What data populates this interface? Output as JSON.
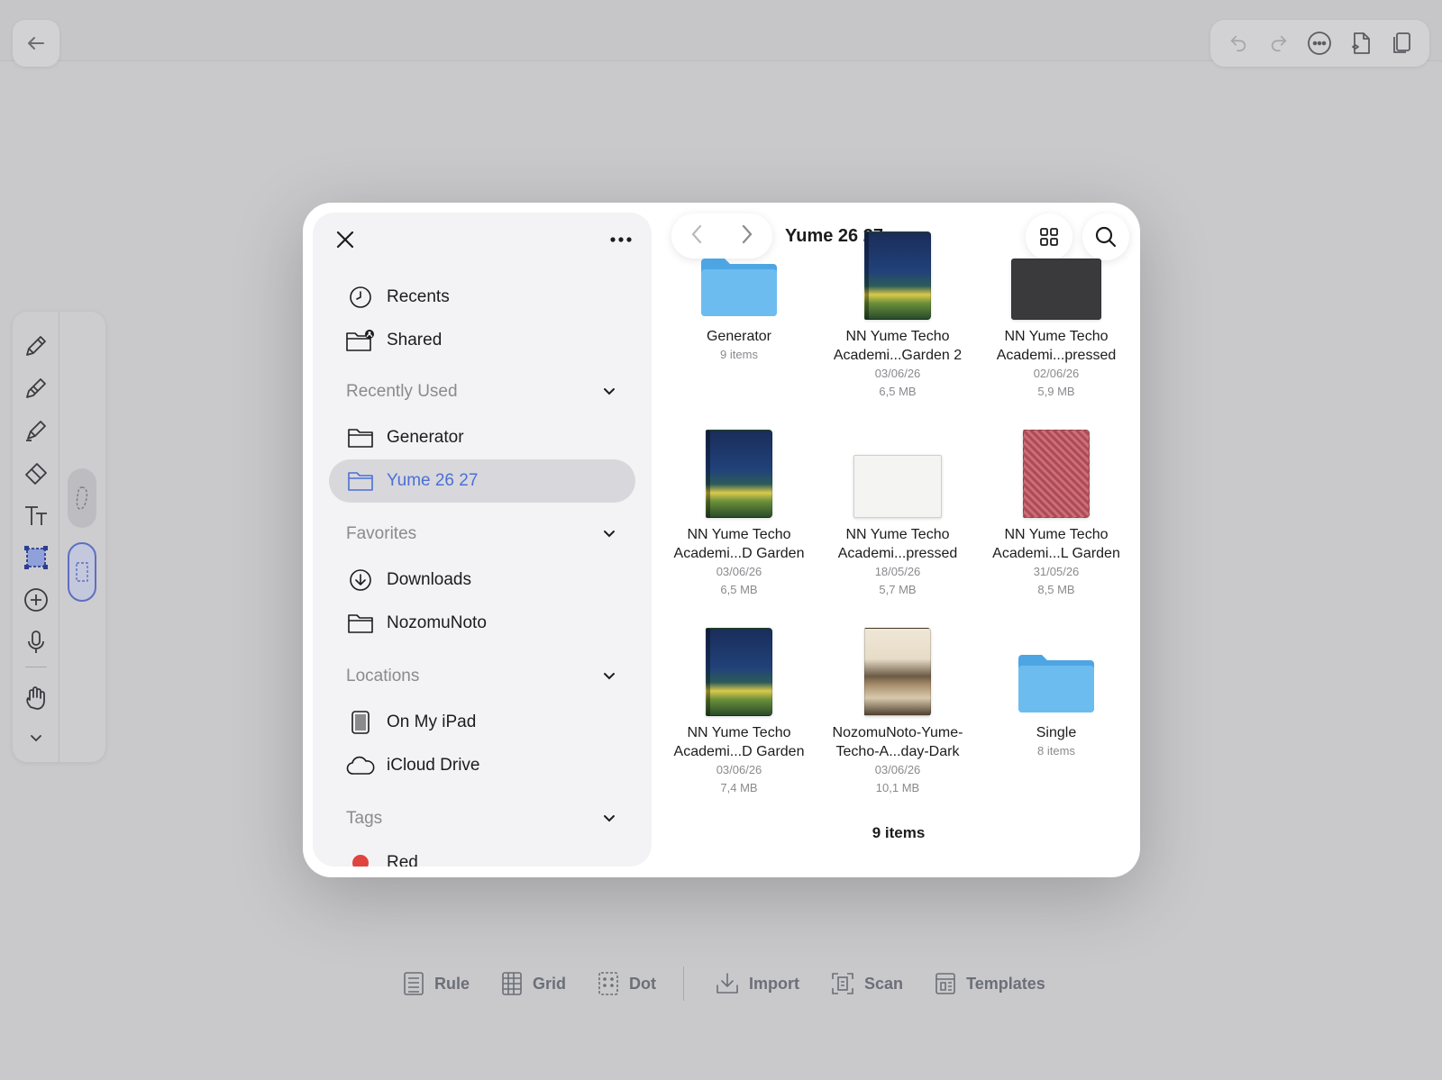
{
  "top_toolbar": {
    "back_icon": "arrow-left-icon",
    "right_icons": [
      "undo-icon",
      "redo-icon",
      "more-circle-icon",
      "new-page-icon",
      "pages-icon"
    ]
  },
  "left_toolbar": {
    "tools": [
      "pen-icon",
      "pencil-icon",
      "highlighter-icon",
      "eraser-icon",
      "text-icon",
      "selection-icon",
      "add-circle-icon",
      "microphone-icon",
      "hand-icon",
      "chevron-down-icon"
    ],
    "modes": [
      "lasso-icon",
      "rect-select-icon"
    ]
  },
  "bottom_bar": {
    "items": [
      {
        "label": "Rule",
        "icon": "rule-icon"
      },
      {
        "label": "Grid",
        "icon": "grid-icon"
      },
      {
        "label": "Dot",
        "icon": "dot-icon"
      },
      {
        "label": "Import",
        "icon": "import-icon"
      },
      {
        "label": "Scan",
        "icon": "scan-icon"
      },
      {
        "label": "Templates",
        "icon": "templates-icon"
      }
    ]
  },
  "sidebar": {
    "top": [
      {
        "label": "Recents",
        "icon": "clock-icon"
      },
      {
        "label": "Shared",
        "icon": "shared-folder-icon"
      }
    ],
    "sections": {
      "recently_used": {
        "title": "Recently Used",
        "items": [
          {
            "label": "Generator",
            "icon": "folder-icon"
          },
          {
            "label": "Yume 26 27",
            "icon": "folder-icon",
            "active": true
          }
        ]
      },
      "favorites": {
        "title": "Favorites",
        "items": [
          {
            "label": "Downloads",
            "icon": "download-icon"
          },
          {
            "label": "NozomuNoto",
            "icon": "folder-icon"
          }
        ]
      },
      "locations": {
        "title": "Locations",
        "items": [
          {
            "label": "On My iPad",
            "icon": "ipad-icon"
          },
          {
            "label": "iCloud Drive",
            "icon": "cloud-icon"
          }
        ]
      },
      "tags": {
        "title": "Tags",
        "items": [
          {
            "label": "Red",
            "color": "#e0443e"
          }
        ]
      }
    }
  },
  "browser": {
    "title": "Yume 26 27",
    "items_count": "9 items",
    "items": [
      {
        "name": [
          "Generator"
        ],
        "meta": [
          "9 items"
        ],
        "kind": "folder"
      },
      {
        "name": [
          "NN Yume Techo",
          "Academi...Garden 2"
        ],
        "meta": [
          "03/06/26",
          "6,5 MB"
        ],
        "kind": "garden"
      },
      {
        "name": [
          "NN Yume Techo",
          "Academi...pressed"
        ],
        "meta": [
          "02/06/26",
          "5,9 MB"
        ],
        "kind": "dark"
      },
      {
        "name": [
          "NN Yume Techo",
          "Academi...D Garden"
        ],
        "meta": [
          "03/06/26",
          "6,5 MB"
        ],
        "kind": "garden"
      },
      {
        "name": [
          "NN Yume Techo",
          "Academi...pressed"
        ],
        "meta": [
          "18/05/26",
          "5,7 MB"
        ],
        "kind": "spread"
      },
      {
        "name": [
          "NN Yume Techo",
          "Academi...L Garden"
        ],
        "meta": [
          "31/05/26",
          "8,5 MB"
        ],
        "kind": "red"
      },
      {
        "name": [
          "NN Yume Techo",
          "Academi...D Garden"
        ],
        "meta": [
          "03/06/26",
          "7,4 MB"
        ],
        "kind": "garden"
      },
      {
        "name": [
          "NozomuNoto-Yume-",
          "Techo-A...day-Dark"
        ],
        "meta": [
          "03/06/26",
          "10,1 MB"
        ],
        "kind": "mountain"
      },
      {
        "name": [
          "Single"
        ],
        "meta": [
          "8 items"
        ],
        "kind": "folder"
      }
    ]
  },
  "colors": {
    "accent": "#4b6fd6",
    "folder_blue": "#5fb4ea",
    "tag_red": "#e0443e"
  }
}
